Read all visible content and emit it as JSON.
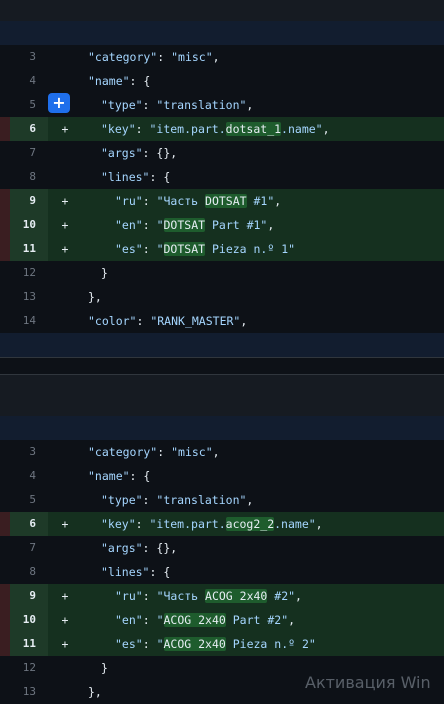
{
  "hunks": [
    {
      "lines": [
        {
          "num": "3",
          "type": "ctx",
          "indent": 0,
          "key": "\"category\"",
          "sep": ": ",
          "val": "\"misc\"",
          "tail": ","
        },
        {
          "num": "4",
          "type": "ctx",
          "indent": 0,
          "key": "\"name\"",
          "sep": ": ",
          "val": "",
          "tail": "{"
        },
        {
          "num": "5",
          "type": "ctx",
          "indent": 1,
          "key": "\"type\"",
          "sep": ": ",
          "val": "\"translation\"",
          "tail": ","
        },
        {
          "num": "6",
          "type": "add",
          "indent": 1,
          "key": "\"key\"",
          "sep": ": ",
          "valParts": [
            "\"item.part.",
            "dotsat_1",
            ".name\""
          ],
          "tail": ","
        },
        {
          "num": "7",
          "type": "ctx",
          "indent": 1,
          "key": "\"args\"",
          "sep": ": ",
          "val": "{}",
          "tail": ","
        },
        {
          "num": "8",
          "type": "ctx",
          "indent": 1,
          "key": "\"lines\"",
          "sep": ": ",
          "val": "",
          "tail": "{"
        },
        {
          "num": "9",
          "type": "add",
          "indent": 2,
          "key": "\"ru\"",
          "sep": ": ",
          "valParts": [
            "\"Часть ",
            "DOTSAT",
            " #1\""
          ],
          "tail": ","
        },
        {
          "num": "10",
          "type": "add",
          "indent": 2,
          "key": "\"en\"",
          "sep": ": ",
          "valParts": [
            "\"",
            "DOTSAT",
            " Part #1\""
          ],
          "tail": ","
        },
        {
          "num": "11",
          "type": "add",
          "indent": 2,
          "key": "\"es\"",
          "sep": ": ",
          "valParts": [
            "\"",
            "DOTSAT",
            " Pieza n.º 1\""
          ],
          "tail": ""
        },
        {
          "num": "12",
          "type": "ctx",
          "indent": 1,
          "key": "",
          "sep": "",
          "val": "",
          "tail": "}"
        },
        {
          "num": "13",
          "type": "ctx",
          "indent": 0,
          "key": "",
          "sep": "",
          "val": "",
          "tail": "},"
        },
        {
          "num": "14",
          "type": "ctx",
          "indent": 0,
          "key": "\"color\"",
          "sep": ": ",
          "val": "\"RANK_MASTER\"",
          "tail": ","
        }
      ]
    },
    {
      "lines": [
        {
          "num": "3",
          "type": "ctx",
          "indent": 0,
          "key": "\"category\"",
          "sep": ": ",
          "val": "\"misc\"",
          "tail": ","
        },
        {
          "num": "4",
          "type": "ctx",
          "indent": 0,
          "key": "\"name\"",
          "sep": ": ",
          "val": "",
          "tail": "{"
        },
        {
          "num": "5",
          "type": "ctx",
          "indent": 1,
          "key": "\"type\"",
          "sep": ": ",
          "val": "\"translation\"",
          "tail": ","
        },
        {
          "num": "6",
          "type": "add",
          "indent": 1,
          "key": "\"key\"",
          "sep": ": ",
          "valParts": [
            "\"item.part.",
            "acog2_2",
            ".name\""
          ],
          "tail": ","
        },
        {
          "num": "7",
          "type": "ctx",
          "indent": 1,
          "key": "\"args\"",
          "sep": ": ",
          "val": "{}",
          "tail": ","
        },
        {
          "num": "8",
          "type": "ctx",
          "indent": 1,
          "key": "\"lines\"",
          "sep": ": ",
          "val": "",
          "tail": "{"
        },
        {
          "num": "9",
          "type": "add",
          "indent": 2,
          "key": "\"ru\"",
          "sep": ": ",
          "valParts": [
            "\"Часть ",
            "ACOG 2x40",
            " #2\""
          ],
          "tail": ","
        },
        {
          "num": "10",
          "type": "add",
          "indent": 2,
          "key": "\"en\"",
          "sep": ": ",
          "valParts": [
            "\"",
            "ACOG 2x40",
            " Part #2\""
          ],
          "tail": ","
        },
        {
          "num": "11",
          "type": "add",
          "indent": 2,
          "key": "\"es\"",
          "sep": ": ",
          "valParts": [
            "\"",
            "ACOG 2x40",
            " Pieza n.º 2\""
          ],
          "tail": ""
        },
        {
          "num": "12",
          "type": "ctx",
          "indent": 1,
          "key": "",
          "sep": "",
          "val": "",
          "tail": "}"
        },
        {
          "num": "13",
          "type": "ctx",
          "indent": 0,
          "key": "",
          "sep": "",
          "val": "",
          "tail": "},"
        }
      ]
    }
  ],
  "add_marker": "+",
  "plus_button": "+",
  "watermark": "Активация Win",
  "colors": {
    "added_bg": "#15301f",
    "added_gutter": "#1e3a28",
    "accent": "#1f6feb",
    "string": "#a5d6ff"
  }
}
